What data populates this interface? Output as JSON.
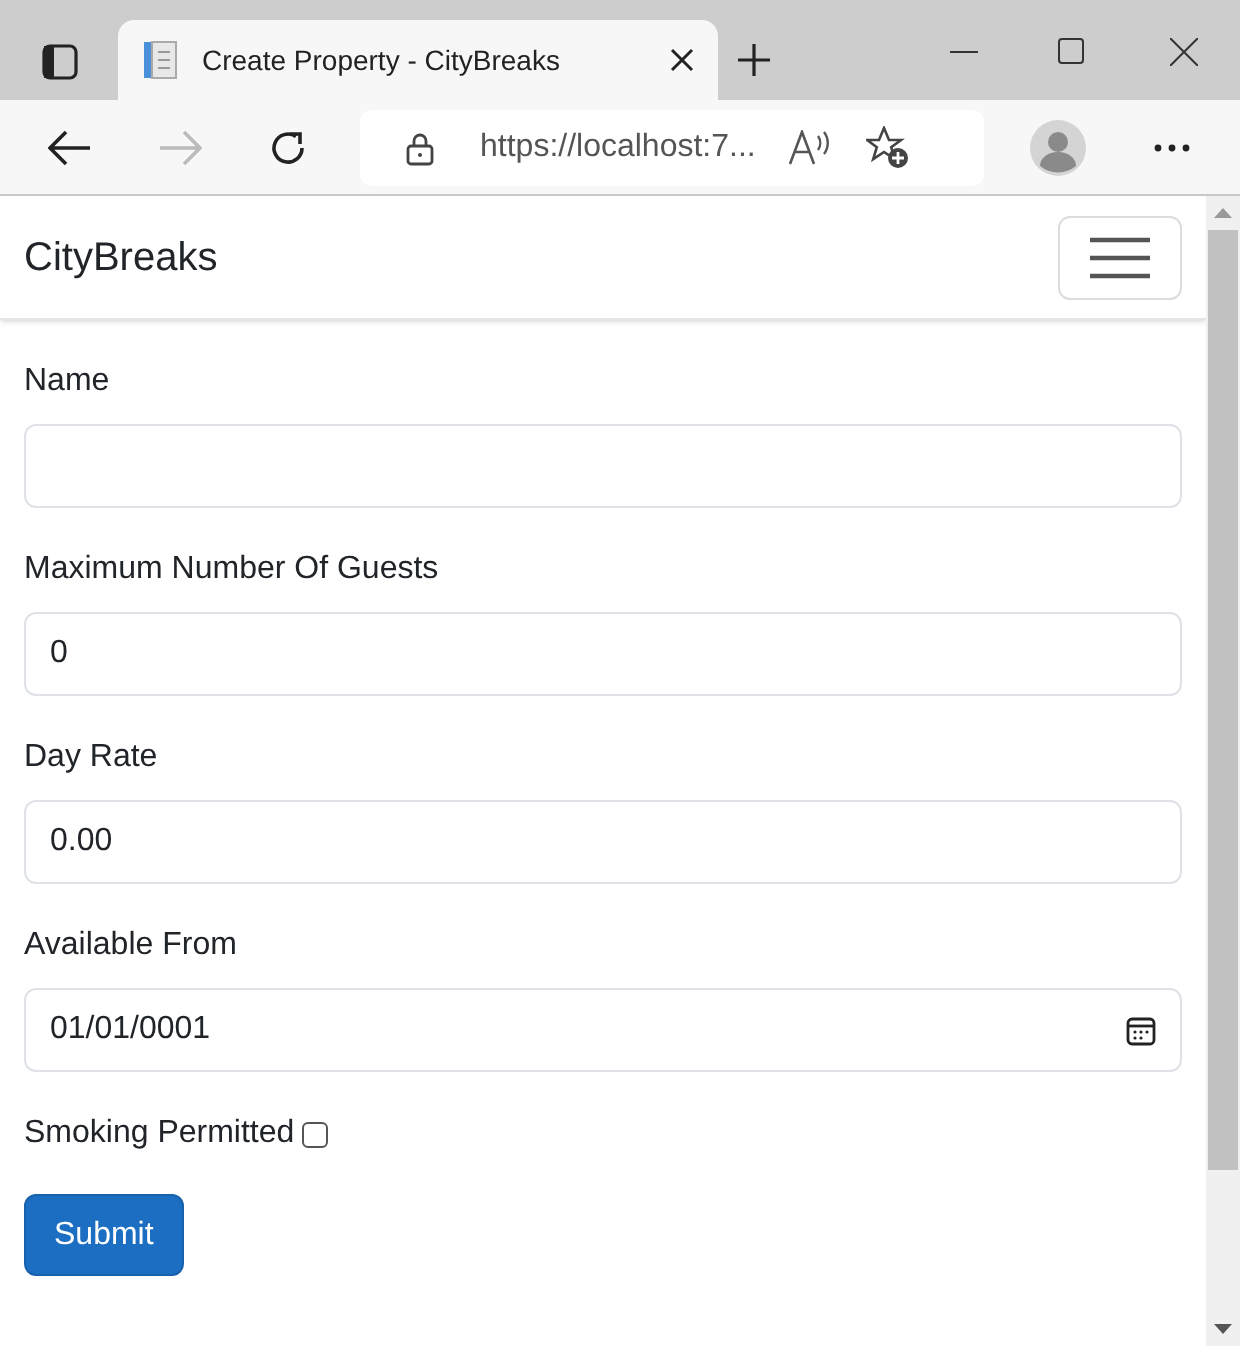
{
  "browser": {
    "tab_title": "Create Property - CityBreaks",
    "url": "https://localhost:7..."
  },
  "navbar": {
    "brand": "CityBreaks"
  },
  "form": {
    "fields": [
      {
        "kind": "text",
        "label": "Name"
      },
      {
        "kind": "text",
        "label": "Maximum Number Of Guests",
        "value": "0"
      },
      {
        "kind": "text",
        "label": "Day Rate",
        "value": "0.00"
      },
      {
        "kind": "date",
        "label": "Available From",
        "value": "01/01/0001"
      }
    ],
    "checkbox": {
      "label": "Smoking Permitted",
      "checked": false
    },
    "submit": "Submit"
  }
}
